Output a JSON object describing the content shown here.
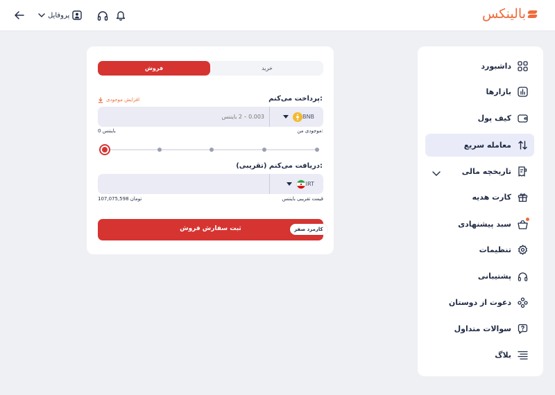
{
  "header": {
    "logo_text": "بالینکس",
    "profile_label": "پروفایل",
    "icons": [
      "back-arrow-icon",
      "chevron-down-icon",
      "user-icon",
      "headphones-icon",
      "bell-icon"
    ]
  },
  "sidebar": {
    "items": [
      {
        "label": "داشبورد",
        "icon": "dashboard-grid-icon"
      },
      {
        "label": "بازارها",
        "icon": "markets-chart-icon"
      },
      {
        "label": "کیف پول",
        "icon": "wallet-icon"
      },
      {
        "label": "معامله سریع",
        "icon": "swap-arrows-icon",
        "active": true
      },
      {
        "label": "تاریخچه مالی",
        "icon": "history-receipt-icon",
        "expandable": true
      },
      {
        "label": "کارت هدیه",
        "icon": "gift-icon"
      },
      {
        "label": "سبد پیشنهادی",
        "icon": "basket-icon",
        "badge_dot": true
      },
      {
        "label": "تنظیمات",
        "icon": "gear-icon"
      },
      {
        "label": "پشتیبانی",
        "icon": "headphones-icon"
      },
      {
        "label": "دعوت از دوستان",
        "icon": "invite-friends-icon"
      },
      {
        "label": "سوالات متداول",
        "icon": "faq-question-icon"
      },
      {
        "label": "بلاگ",
        "icon": "blog-lines-icon"
      }
    ]
  },
  "trade": {
    "tabs": {
      "buy": "خرید",
      "sell": "فروش",
      "active": "sell"
    },
    "pay": {
      "label": "پرداخت می‌کنم:",
      "increase_label": "افزایش موجودی",
      "currency": "BNB",
      "placeholder": "0.003 – 2 بایننس",
      "balance_label": "موجودی من:",
      "balance_value": "0 بایننس"
    },
    "slider": {
      "value": 0,
      "stops": [
        "0%",
        "25%",
        "50%",
        "75%",
        "100%"
      ]
    },
    "receive": {
      "label": "دریافت می‌کنم (تقریبی):",
      "currency": "IRT",
      "value": "",
      "price_label": "قیمت تقریبی بایننس",
      "price_value": "107,075,598 تومان"
    },
    "submit_label": "ثبت سفارش فروش",
    "fee_badge": "کارمزد صفر"
  },
  "colors": {
    "accent": "#d63431",
    "brand": "#f06a3a",
    "bnb": "#f3ba2f",
    "active_nav": "#e9ebf8"
  }
}
